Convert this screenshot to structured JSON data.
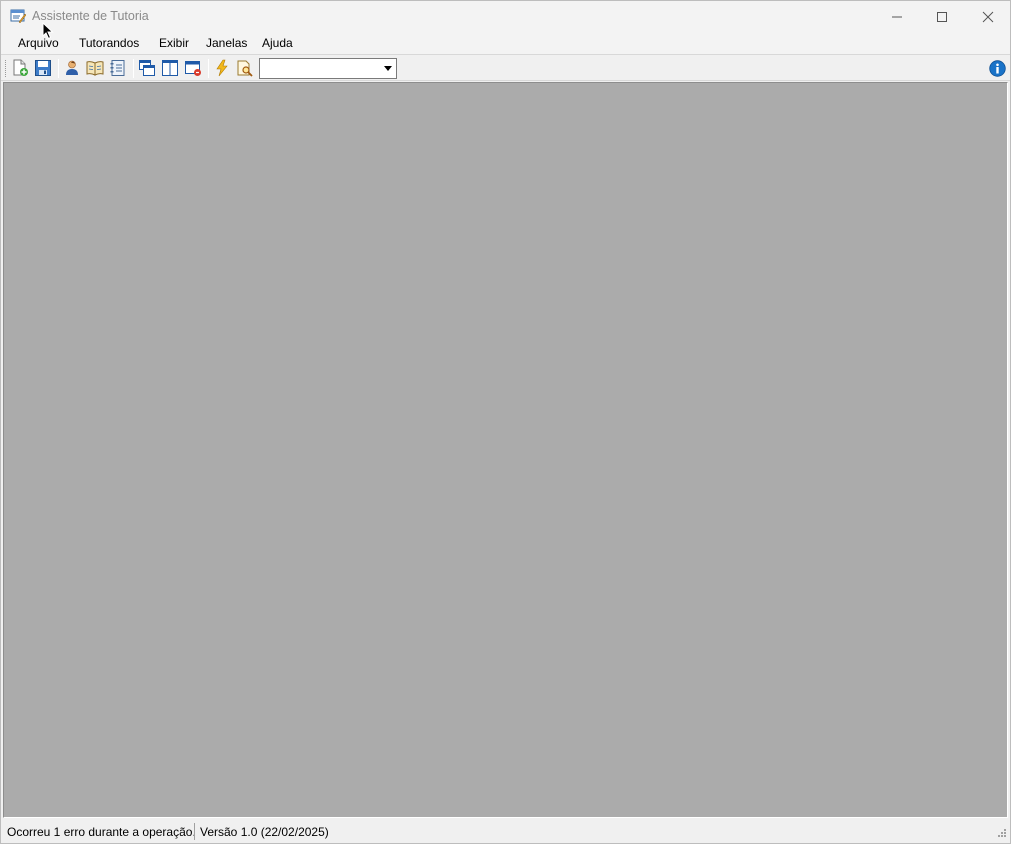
{
  "window": {
    "title": "Assistente de Tutoria",
    "controls": {
      "minimize": "minimize-icon",
      "maximize": "maximize-icon",
      "close": "close-icon"
    }
  },
  "menu": {
    "items": [
      {
        "label": "Arquivo"
      },
      {
        "label": "Tutorandos"
      },
      {
        "label": "Exibir"
      },
      {
        "label": "Janelas"
      },
      {
        "label": "Ajuda"
      }
    ]
  },
  "toolbar": {
    "buttons": [
      {
        "icon": "new-document-icon"
      },
      {
        "icon": "save-icon"
      },
      {
        "icon": "user-icon"
      },
      {
        "icon": "book-icon"
      },
      {
        "icon": "address-book-icon"
      },
      {
        "icon": "cascade-windows-icon"
      },
      {
        "icon": "tile-vertical-icon"
      },
      {
        "icon": "close-window-icon"
      },
      {
        "icon": "lightning-icon"
      },
      {
        "icon": "search-document-icon"
      }
    ],
    "combo": {
      "value": ""
    },
    "info": {
      "icon": "info-icon"
    }
  },
  "status": {
    "message": "Ocorreu 1 erro durante a operação.",
    "version": "Versão 1.0 (22/02/2025)"
  },
  "colors": {
    "mdi_background": "#ababab",
    "chrome": "#f0f0f0",
    "title_text": "#8a8a8a",
    "info_blue": "#1a73c8"
  }
}
